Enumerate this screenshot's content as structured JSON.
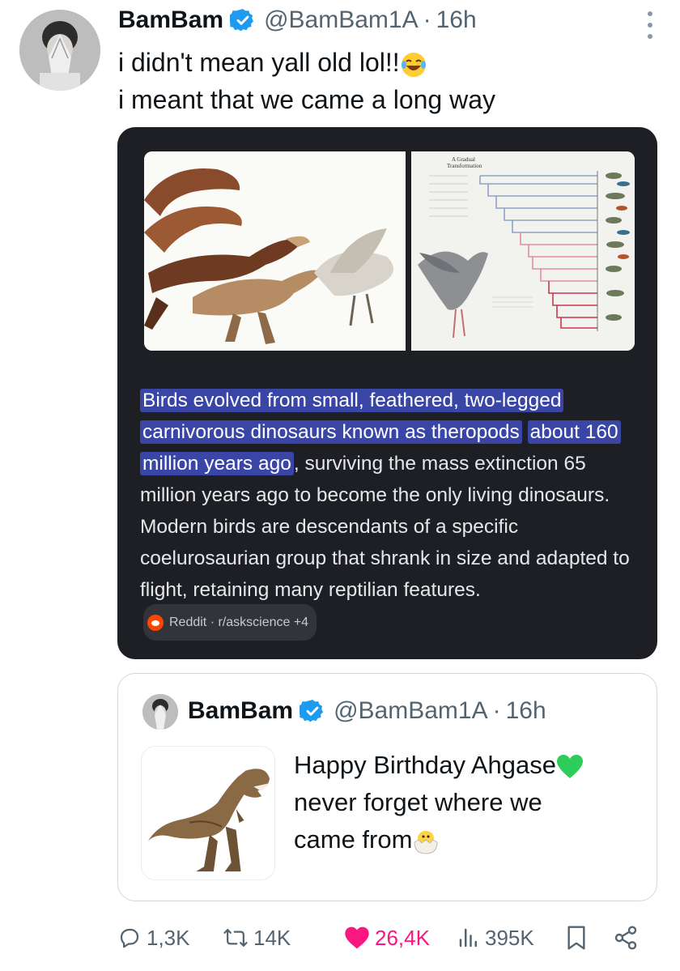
{
  "tweet": {
    "author_name": "BamBam",
    "handle": "@BamBam1A",
    "separator": "·",
    "time": "16h",
    "text_line1": "i didn't mean yall old lol!!",
    "text_line2": "i meant that we came a long way",
    "emoji": "laughing-face-emoji"
  },
  "media": {
    "left_image": "dinosaur-to-bird-evolution-illustration",
    "right_image": "gradual-transformation-chart",
    "right_image_title": "A Gradual\nTransformation",
    "ai_text_highlighted_1": "Birds evolved from small, feathered, two-legged",
    "ai_text_highlighted_2": "carnivorous dinosaurs known as theropods",
    "ai_text_highlighted_3": "about 160 million years ago",
    "ai_text_rest": ", surviving the mass extinction 65 million years ago to become the only living dinosaurs. Modern birds are descendants of a specific coelurosaurian group that shrank in size and adapted to flight, retaining many reptilian features.",
    "source_label": "Reddit · r/askscience +4"
  },
  "quoted": {
    "author_name": "BamBam",
    "handle": "@BamBam1A",
    "separator": "·",
    "time": "16h",
    "text_line1": "Happy Birthday Ahgase",
    "text_line2": "never forget where we",
    "text_line3": "came from",
    "emoji1": "green-heart-emoji",
    "emoji2": "hatching-chick-emoji",
    "thumbnail": "t-rex-image"
  },
  "actions": {
    "replies": "1,3K",
    "retweets": "14K",
    "likes": "26,4K",
    "views": "395K"
  },
  "colors": {
    "verified": "#1d9bf0",
    "like": "#f91880",
    "media_bg": "#1e1f24",
    "highlight": "#3a46a6"
  }
}
